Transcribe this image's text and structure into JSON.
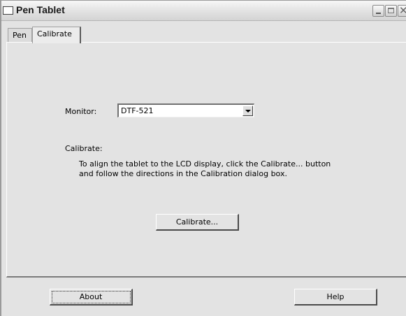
{
  "window": {
    "title": "Pen Tablet"
  },
  "tabs": [
    {
      "label": "Pen",
      "selected": false
    },
    {
      "label": "Calibrate",
      "selected": true
    }
  ],
  "calibrate_panel": {
    "monitor_label": "Monitor:",
    "monitor_value": "DTF-521",
    "heading": "Calibrate:",
    "instructions": "To align the tablet to the LCD display, click the Calibrate... button and follow the directions in the Calibration dialog box.",
    "calibrate_button": "Calibrate..."
  },
  "footer": {
    "about_button": "About",
    "help_button": "Help"
  }
}
